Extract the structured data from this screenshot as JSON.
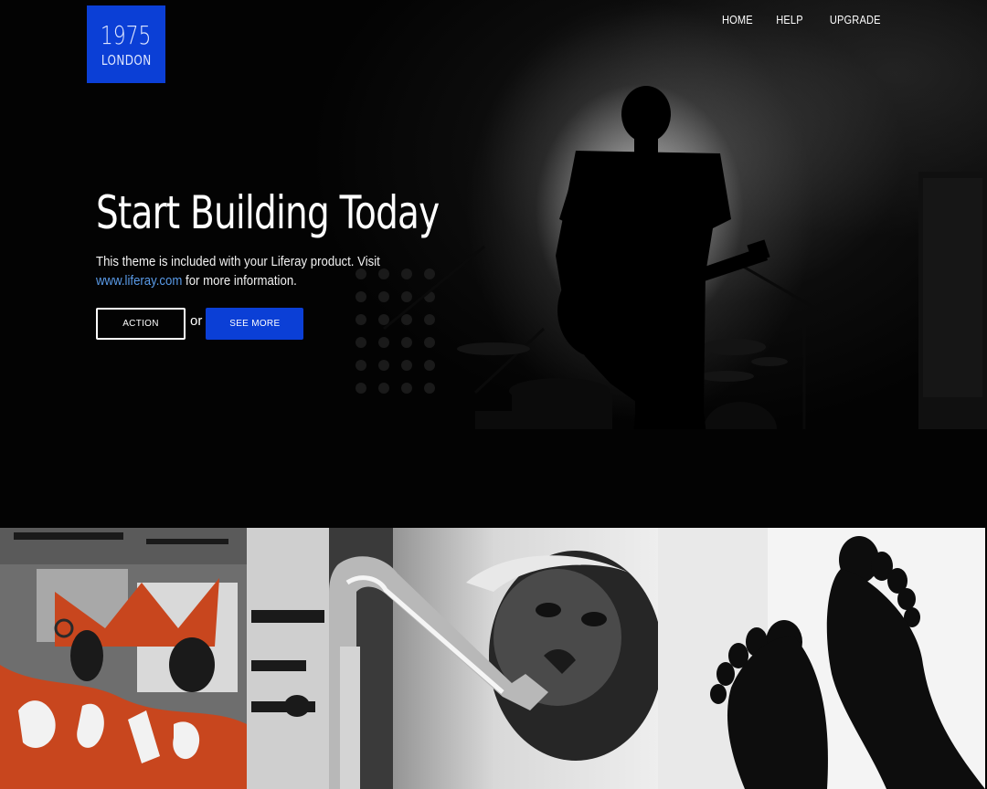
{
  "logo": {
    "year": "1975",
    "city": "LONDON"
  },
  "nav": {
    "items": [
      {
        "label": "HOME"
      },
      {
        "label": "HELP"
      },
      {
        "label": "UPGRADE"
      }
    ]
  },
  "hero": {
    "headline": "Start Building Today",
    "lead_before_link": "This theme is included with your Liferay product. Visit ",
    "link_text": "www.liferay.com",
    "lead_after_link": " for more information.",
    "action_label": "ACTION",
    "or_text": "or",
    "see_more_label": "SEE MORE"
  },
  "colors": {
    "brand_blue": "#0b3fd6",
    "link_blue": "#5a9be8",
    "graffiti_orange": "#c8461e"
  },
  "gallery": {
    "tiles": [
      {
        "subject": "graffiti-wall-photo"
      },
      {
        "subject": "saxophone-player-photo"
      },
      {
        "subject": "feet-silhouette-photo"
      }
    ]
  }
}
